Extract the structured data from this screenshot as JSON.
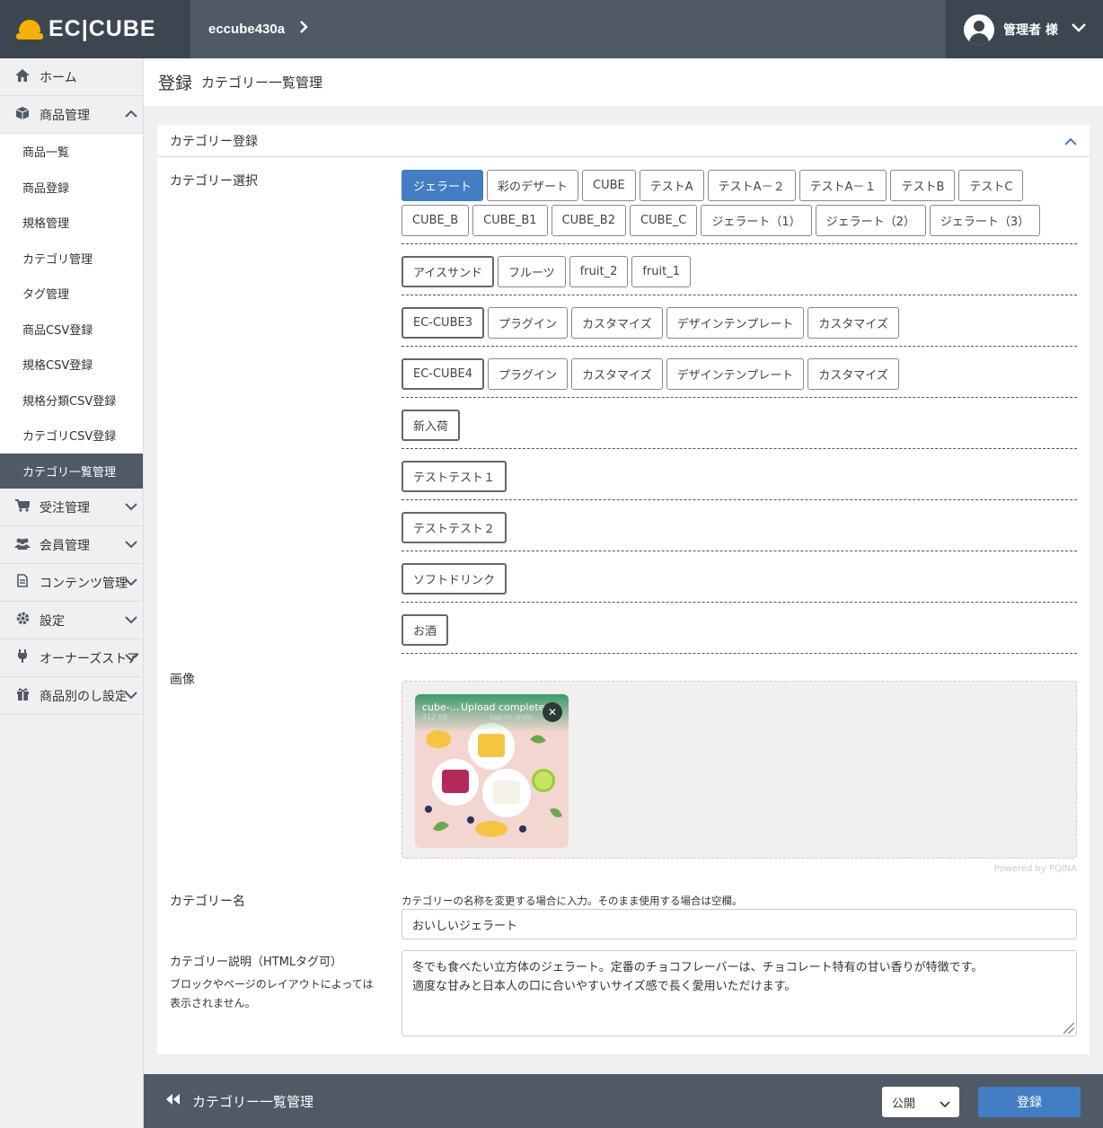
{
  "header": {
    "logo_text": "EC|CUBE",
    "shop_name": "eccube430a",
    "user_name": "管理者 様"
  },
  "sidebar": {
    "home": "ホーム",
    "product": "商品管理",
    "product_items": [
      "商品一覧",
      "商品登録",
      "規格管理",
      "カテゴリ管理",
      "タグ管理",
      "商品CSV登録",
      "規格CSV登録",
      "規格分類CSV登録",
      "カテゴリCSV登録",
      "カテゴリ一覧管理"
    ],
    "order": "受注管理",
    "customer": "会員管理",
    "content": "コンテンツ管理",
    "setting": "設定",
    "store": "オーナーズストア",
    "noshi": "商品別のし設定"
  },
  "page": {
    "title": "登録",
    "subtitle": "カテゴリー一覧管理"
  },
  "card": {
    "title": "カテゴリー登録",
    "select_label": "カテゴリー選択",
    "image_label": "画像",
    "name_label": "カテゴリー名",
    "desc_label": "カテゴリー説明（HTMLタグ可）",
    "desc_note": "ブロックやページのレイアウトによっては表示されません。"
  },
  "categories": {
    "group1": [
      "ジェラート",
      "彩のデザート",
      "CUBE",
      "テストA",
      "テストA－２",
      "テストA－１",
      "テストB",
      "テストC",
      "CUBE_B",
      "CUBE_B1",
      "CUBE_B2",
      "CUBE_C",
      "ジェラート（1）",
      "ジェラート（2）",
      "ジェラート（3）"
    ],
    "group2": [
      "アイスサンド",
      "フルーツ",
      "fruit_2",
      "fruit_1"
    ],
    "group3": [
      "EC-CUBE3",
      "プラグイン",
      "カスタマイズ",
      "デザインテンプレート",
      "カスタマイズ"
    ],
    "group4": [
      "EC-CUBE4",
      "プラグイン",
      "カスタマイズ",
      "デザインテンプレート",
      "カスタマイズ"
    ],
    "group5": [
      "新入荷"
    ],
    "group6": [
      "テストテスト１"
    ],
    "group7": [
      "テストテスト２"
    ],
    "group8": [
      "ソフトドリンク"
    ],
    "group9": [
      "お酒"
    ]
  },
  "upload": {
    "file_name": "cube-...",
    "file_size": "412 KB",
    "status": "Upload complete",
    "undo": "tap to undo",
    "powered": "Powered by PQINA"
  },
  "form": {
    "name_hint": "カテゴリーの名称を変更する場合に入力。そのまま使用する場合は空欄。",
    "name_value": "おいしいジェラート",
    "desc_line1": "冬でも食べたい立方体のジェラート。定番のチョコフレーバーは、チョコレート特有の甘い香りが特徴です。",
    "desc_line2": "適度な甘みと日本人の口に合いやすいサイズ感で長く愛用いただけます。"
  },
  "footer": {
    "back_label": "カテゴリー一覧管理",
    "visibility": "公開",
    "save_label": "登録"
  }
}
